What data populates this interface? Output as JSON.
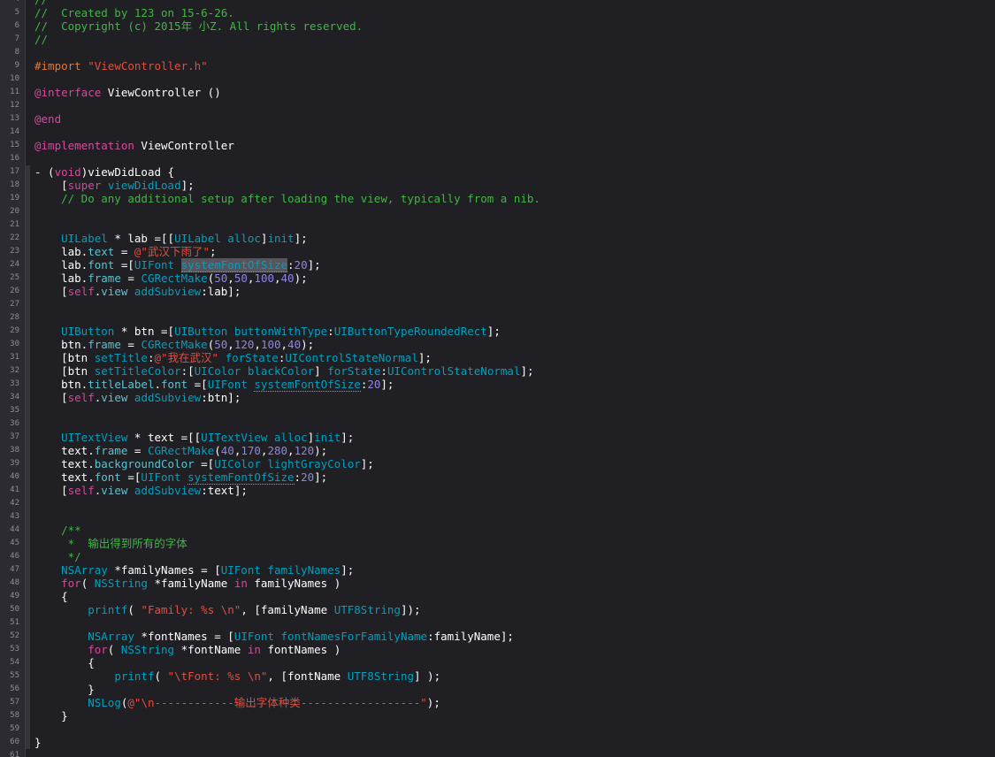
{
  "lines": [
    {
      "n": "4",
      "tokens": [
        [
          "cmt",
          "//"
        ]
      ]
    },
    {
      "n": "5",
      "tokens": [
        [
          "cmt",
          "//  Created by 123 on 15-6-26."
        ]
      ]
    },
    {
      "n": "6",
      "tokens": [
        [
          "cmt",
          "//  Copyright (c) 2015年 小Z. All rights reserved."
        ]
      ]
    },
    {
      "n": "7",
      "tokens": [
        [
          "cmt",
          "//"
        ]
      ]
    },
    {
      "n": "8",
      "tokens": []
    },
    {
      "n": "9",
      "tokens": [
        [
          "macro",
          "#import "
        ],
        [
          "str",
          "\"ViewController.h\""
        ]
      ]
    },
    {
      "n": "10",
      "tokens": []
    },
    {
      "n": "11",
      "tokens": [
        [
          "kw",
          "@interface"
        ],
        [
          "",
          " ViewController ()"
        ]
      ]
    },
    {
      "n": "12",
      "tokens": []
    },
    {
      "n": "13",
      "tokens": [
        [
          "kw",
          "@end"
        ]
      ]
    },
    {
      "n": "14",
      "tokens": []
    },
    {
      "n": "15",
      "tokens": [
        [
          "kw",
          "@implementation"
        ],
        [
          "",
          " ViewController"
        ]
      ]
    },
    {
      "n": "16",
      "tokens": []
    },
    {
      "n": "17",
      "tokens": [
        [
          "",
          "- ("
        ],
        [
          "kw",
          "void"
        ],
        [
          "",
          ")viewDidLoad {"
        ]
      ]
    },
    {
      "n": "18",
      "tokens": [
        [
          "",
          "    ["
        ],
        [
          "kw",
          "super"
        ],
        [
          "",
          " "
        ],
        [
          "mth",
          "viewDidLoad"
        ],
        [
          "",
          "];"
        ]
      ]
    },
    {
      "n": "19",
      "tokens": [
        [
          "cmt",
          "    // Do any additional setup after loading the view, typically from a nib."
        ]
      ]
    },
    {
      "n": "20",
      "tokens": []
    },
    {
      "n": "21",
      "tokens": []
    },
    {
      "n": "22",
      "tokens": [
        [
          "",
          "    "
        ],
        [
          "cls",
          "UILabel"
        ],
        [
          "",
          " * lab =[["
        ],
        [
          "cls",
          "UILabel"
        ],
        [
          "",
          " "
        ],
        [
          "mth",
          "alloc"
        ],
        [
          "",
          "]"
        ],
        [
          "mth",
          "init"
        ],
        [
          "",
          "];"
        ]
      ]
    },
    {
      "n": "23",
      "tokens": [
        [
          "",
          "    lab."
        ],
        [
          "prop",
          "text"
        ],
        [
          "",
          " = "
        ],
        [
          "str",
          "@\"武汉下雨了\""
        ],
        [
          "",
          ";"
        ]
      ]
    },
    {
      "n": "24",
      "tokens": [
        [
          "",
          "    lab."
        ],
        [
          "prop",
          "font"
        ],
        [
          "",
          " =["
        ],
        [
          "cls",
          "UIFont"
        ],
        [
          "",
          " "
        ],
        [
          "mth sel",
          "systemFontOfSize"
        ],
        [
          "",
          ":"
        ],
        [
          "num",
          "20"
        ],
        [
          "",
          "];"
        ]
      ]
    },
    {
      "n": "25",
      "tokens": [
        [
          "",
          "    lab."
        ],
        [
          "prop",
          "frame"
        ],
        [
          "",
          " = "
        ],
        [
          "mth",
          "CGRectMake"
        ],
        [
          "",
          "("
        ],
        [
          "num",
          "50"
        ],
        [
          "",
          ","
        ],
        [
          "num",
          "50"
        ],
        [
          "",
          ","
        ],
        [
          "num",
          "100"
        ],
        [
          "",
          ","
        ],
        [
          "num",
          "40"
        ],
        [
          "",
          ");"
        ]
      ]
    },
    {
      "n": "26",
      "tokens": [
        [
          "",
          "    ["
        ],
        [
          "kw",
          "self"
        ],
        [
          "",
          "."
        ],
        [
          "prop",
          "view"
        ],
        [
          "",
          " "
        ],
        [
          "mth",
          "addSubview"
        ],
        [
          "",
          ":lab];"
        ]
      ]
    },
    {
      "n": "27",
      "tokens": []
    },
    {
      "n": "28",
      "tokens": []
    },
    {
      "n": "29",
      "tokens": [
        [
          "",
          "    "
        ],
        [
          "cls",
          "UIButton"
        ],
        [
          "",
          " * btn =["
        ],
        [
          "cls",
          "UIButton"
        ],
        [
          "",
          " "
        ],
        [
          "mth",
          "buttonWithType"
        ],
        [
          "",
          ":"
        ],
        [
          "cls",
          "UIButtonTypeRoundedRect"
        ],
        [
          "",
          "];"
        ]
      ]
    },
    {
      "n": "30",
      "tokens": [
        [
          "",
          "    btn."
        ],
        [
          "prop",
          "frame"
        ],
        [
          "",
          " = "
        ],
        [
          "mth",
          "CGRectMake"
        ],
        [
          "",
          "("
        ],
        [
          "num",
          "50"
        ],
        [
          "",
          ","
        ],
        [
          "num",
          "120"
        ],
        [
          "",
          ","
        ],
        [
          "num",
          "100"
        ],
        [
          "",
          ","
        ],
        [
          "num",
          "40"
        ],
        [
          "",
          ");"
        ]
      ]
    },
    {
      "n": "31",
      "tokens": [
        [
          "",
          "    [btn "
        ],
        [
          "mth",
          "setTitle"
        ],
        [
          "",
          ":"
        ],
        [
          "str",
          "@\"我在武汉\""
        ],
        [
          "",
          " "
        ],
        [
          "mth",
          "forState"
        ],
        [
          "",
          ":"
        ],
        [
          "cls",
          "UIControlStateNormal"
        ],
        [
          "",
          "];"
        ]
      ]
    },
    {
      "n": "32",
      "tokens": [
        [
          "",
          "    [btn "
        ],
        [
          "mth",
          "setTitleColor"
        ],
        [
          "",
          ":["
        ],
        [
          "cls",
          "UIColor"
        ],
        [
          "",
          " "
        ],
        [
          "mth",
          "blackColor"
        ],
        [
          "",
          "] "
        ],
        [
          "mth",
          "forState"
        ],
        [
          "",
          ":"
        ],
        [
          "cls",
          "UIControlStateNormal"
        ],
        [
          "",
          "];"
        ]
      ]
    },
    {
      "n": "33",
      "tokens": [
        [
          "",
          "    btn."
        ],
        [
          "prop",
          "titleLabel"
        ],
        [
          "",
          "."
        ],
        [
          "prop",
          "font"
        ],
        [
          "",
          " =["
        ],
        [
          "cls",
          "UIFont"
        ],
        [
          "",
          " "
        ],
        [
          "mth ul",
          "systemFontOfSize"
        ],
        [
          "",
          ":"
        ],
        [
          "num",
          "20"
        ],
        [
          "",
          "];"
        ]
      ]
    },
    {
      "n": "34",
      "tokens": [
        [
          "",
          "    ["
        ],
        [
          "kw",
          "self"
        ],
        [
          "",
          "."
        ],
        [
          "prop",
          "view"
        ],
        [
          "",
          " "
        ],
        [
          "mth",
          "addSubview"
        ],
        [
          "",
          ":btn];"
        ]
      ]
    },
    {
      "n": "35",
      "tokens": []
    },
    {
      "n": "36",
      "tokens": []
    },
    {
      "n": "37",
      "tokens": [
        [
          "",
          "    "
        ],
        [
          "cls",
          "UITextView"
        ],
        [
          "",
          " * text =[["
        ],
        [
          "cls",
          "UITextView"
        ],
        [
          "",
          " "
        ],
        [
          "mth",
          "alloc"
        ],
        [
          "",
          "]"
        ],
        [
          "mth",
          "init"
        ],
        [
          "",
          "];"
        ]
      ]
    },
    {
      "n": "38",
      "tokens": [
        [
          "",
          "    text."
        ],
        [
          "prop",
          "frame"
        ],
        [
          "",
          " = "
        ],
        [
          "mth",
          "CGRectMake"
        ],
        [
          "",
          "("
        ],
        [
          "num",
          "40"
        ],
        [
          "",
          ","
        ],
        [
          "num",
          "170"
        ],
        [
          "",
          ","
        ],
        [
          "num",
          "280"
        ],
        [
          "",
          ","
        ],
        [
          "num",
          "120"
        ],
        [
          "",
          ");"
        ]
      ]
    },
    {
      "n": "39",
      "tokens": [
        [
          "",
          "    text."
        ],
        [
          "prop",
          "backgroundColor"
        ],
        [
          "",
          " =["
        ],
        [
          "cls",
          "UIColor"
        ],
        [
          "",
          " "
        ],
        [
          "mth",
          "lightGrayColor"
        ],
        [
          "",
          "];"
        ]
      ]
    },
    {
      "n": "40",
      "tokens": [
        [
          "",
          "    text."
        ],
        [
          "prop",
          "font"
        ],
        [
          "",
          " =["
        ],
        [
          "cls",
          "UIFont"
        ],
        [
          "",
          " "
        ],
        [
          "mth ul",
          "systemFontOfSize"
        ],
        [
          "",
          ":"
        ],
        [
          "num",
          "20"
        ],
        [
          "",
          "];"
        ]
      ]
    },
    {
      "n": "41",
      "tokens": [
        [
          "",
          "    ["
        ],
        [
          "kw",
          "self"
        ],
        [
          "",
          "."
        ],
        [
          "prop",
          "view"
        ],
        [
          "",
          " "
        ],
        [
          "mth",
          "addSubview"
        ],
        [
          "",
          ":text];"
        ]
      ]
    },
    {
      "n": "42",
      "tokens": []
    },
    {
      "n": "43",
      "tokens": []
    },
    {
      "n": "44",
      "tokens": [
        [
          "cmt",
          "    /**"
        ]
      ]
    },
    {
      "n": "45",
      "tokens": [
        [
          "cmt",
          "     *  输出得到所有的字体"
        ]
      ]
    },
    {
      "n": "46",
      "tokens": [
        [
          "cmt",
          "     */"
        ]
      ]
    },
    {
      "n": "47",
      "tokens": [
        [
          "",
          "    "
        ],
        [
          "cls",
          "NSArray"
        ],
        [
          "",
          " *familyNames = ["
        ],
        [
          "cls",
          "UIFont"
        ],
        [
          "",
          " "
        ],
        [
          "mth",
          "familyNames"
        ],
        [
          "",
          "];"
        ]
      ]
    },
    {
      "n": "48",
      "tokens": [
        [
          "",
          "    "
        ],
        [
          "kw",
          "for"
        ],
        [
          "",
          "( "
        ],
        [
          "cls",
          "NSString"
        ],
        [
          "",
          " *familyName "
        ],
        [
          "kw",
          "in"
        ],
        [
          "",
          " familyNames )"
        ]
      ]
    },
    {
      "n": "49",
      "tokens": [
        [
          "",
          "    {"
        ]
      ]
    },
    {
      "n": "50",
      "tokens": [
        [
          "",
          "        "
        ],
        [
          "mth",
          "printf"
        ],
        [
          "",
          "( "
        ],
        [
          "str",
          "\"Family: %s \\n\""
        ],
        [
          "",
          ", [familyName "
        ],
        [
          "mth",
          "UTF8String"
        ],
        [
          "",
          "]);"
        ]
      ]
    },
    {
      "n": "51",
      "tokens": []
    },
    {
      "n": "52",
      "tokens": [
        [
          "",
          "        "
        ],
        [
          "cls",
          "NSArray"
        ],
        [
          "",
          " *fontNames = ["
        ],
        [
          "cls",
          "UIFont"
        ],
        [
          "",
          " "
        ],
        [
          "mth",
          "fontNamesForFamilyName"
        ],
        [
          "",
          ":familyName];"
        ]
      ]
    },
    {
      "n": "53",
      "tokens": [
        [
          "",
          "        "
        ],
        [
          "kw",
          "for"
        ],
        [
          "",
          "( "
        ],
        [
          "cls",
          "NSString"
        ],
        [
          "",
          " *fontName "
        ],
        [
          "kw",
          "in"
        ],
        [
          "",
          " fontNames )"
        ]
      ]
    },
    {
      "n": "54",
      "tokens": [
        [
          "",
          "        {"
        ]
      ]
    },
    {
      "n": "55",
      "tokens": [
        [
          "",
          "            "
        ],
        [
          "mth",
          "printf"
        ],
        [
          "",
          "( "
        ],
        [
          "str",
          "\"\\tFont: %s \\n\""
        ],
        [
          "",
          ", [fontName "
        ],
        [
          "mth",
          "UTF8String"
        ],
        [
          "",
          "] );"
        ]
      ]
    },
    {
      "n": "56",
      "tokens": [
        [
          "",
          "        }"
        ]
      ]
    },
    {
      "n": "57",
      "tokens": [
        [
          "",
          "        "
        ],
        [
          "mth",
          "NSLog"
        ],
        [
          "",
          "("
        ],
        [
          "str",
          "@\"\\n------------输出字体种类------------------\""
        ],
        [
          "",
          ");"
        ]
      ]
    },
    {
      "n": "58",
      "tokens": [
        [
          "",
          "    }"
        ]
      ]
    },
    {
      "n": "59",
      "tokens": []
    },
    {
      "n": "60",
      "tokens": [
        [
          "",
          "}"
        ]
      ]
    },
    {
      "n": "61",
      "tokens": []
    }
  ]
}
